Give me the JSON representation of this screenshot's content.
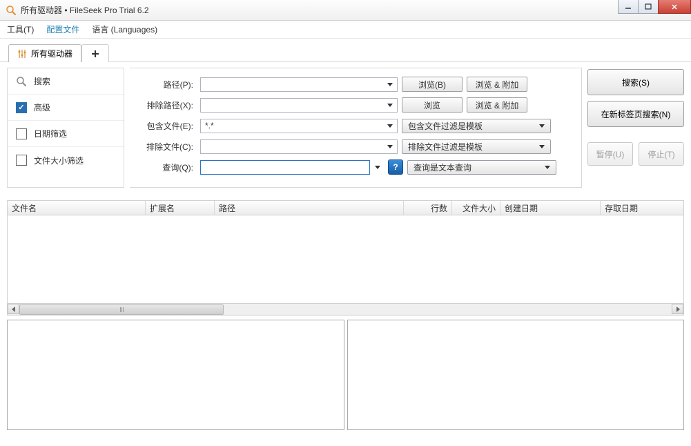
{
  "window": {
    "title": "所有驱动器 • FileSeek Pro Trial 6.2"
  },
  "menu": {
    "tools": "工具(T)",
    "profiles": "配置文件",
    "languages": "语言 (Languages)"
  },
  "tabs": {
    "active": "所有驱动器"
  },
  "sidebar": {
    "search": "搜索",
    "advanced": "高级",
    "date_filter": "日期筛选",
    "size_filter": "文件大小筛选"
  },
  "form": {
    "path_label": "路径(P):",
    "exclude_path_label": "排除路径(X):",
    "include_files_label": "包含文件(E):",
    "include_files_value": "*.*",
    "exclude_files_label": "排除文件(C):",
    "query_label": "查询(Q):",
    "browse_b": "浏览(B)",
    "browse": "浏览",
    "browse_append": "浏览 & 附加",
    "include_filter_mode": "包含文件过滤是模板",
    "exclude_filter_mode": "排除文件过滤是模板",
    "query_mode": "查询是文本查询"
  },
  "actions": {
    "search": "搜索(S)",
    "search_new_tab": "在新标签页搜索(N)",
    "pause": "暂停(U)",
    "stop": "停止(T)"
  },
  "grid": {
    "filename": "文件名",
    "extension": "扩展名",
    "path": "路径",
    "lines": "行数",
    "filesize": "文件大小",
    "created": "创建日期",
    "accessed": "存取日期"
  }
}
